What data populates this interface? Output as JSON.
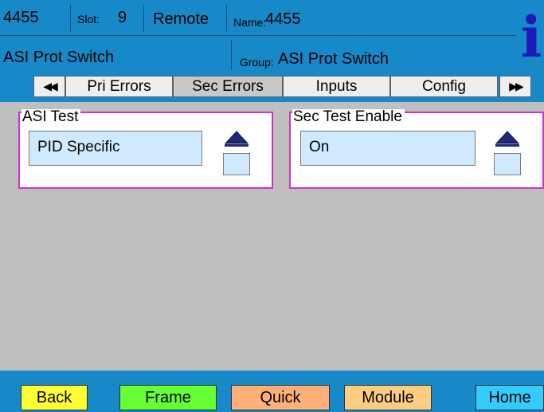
{
  "header": {
    "id": "4455",
    "slot_label": "Slot:",
    "slot_value": "9",
    "mode": "Remote",
    "name_label": "Name:",
    "name_value": "4455",
    "card_type": "ASI Prot Switch",
    "group_label": "Group:",
    "group_value": "ASI Prot Switch",
    "info_icon": "i"
  },
  "tabs": {
    "prev_arrow": "◀◀",
    "next_arrow": "▶▶",
    "items": [
      {
        "label": "Pri Errors"
      },
      {
        "label": "Sec Errors"
      },
      {
        "label": "Inputs"
      },
      {
        "label": "Config"
      }
    ],
    "selected_index": 1
  },
  "controls": [
    {
      "title": "ASI Test",
      "value": "PID Specific"
    },
    {
      "title": "Sec Test Enable",
      "value": "On"
    }
  ],
  "footer": {
    "buttons": [
      {
        "label": "Back",
        "color": "#ffff33"
      },
      {
        "label": "Frame",
        "color": "#66ff33"
      },
      {
        "label": "Quick",
        "color": "#ffb07a"
      },
      {
        "label": "Module",
        "color": "#ffcc80"
      },
      {
        "label": "Home",
        "color": "#33ccff"
      }
    ]
  },
  "colors": {
    "header_bg": "#1789c8",
    "content_bg": "#bfbfbf",
    "group_border": "#cc33cc",
    "value_bg": "#cfeaff",
    "info_icon": "#1a1ab8"
  }
}
